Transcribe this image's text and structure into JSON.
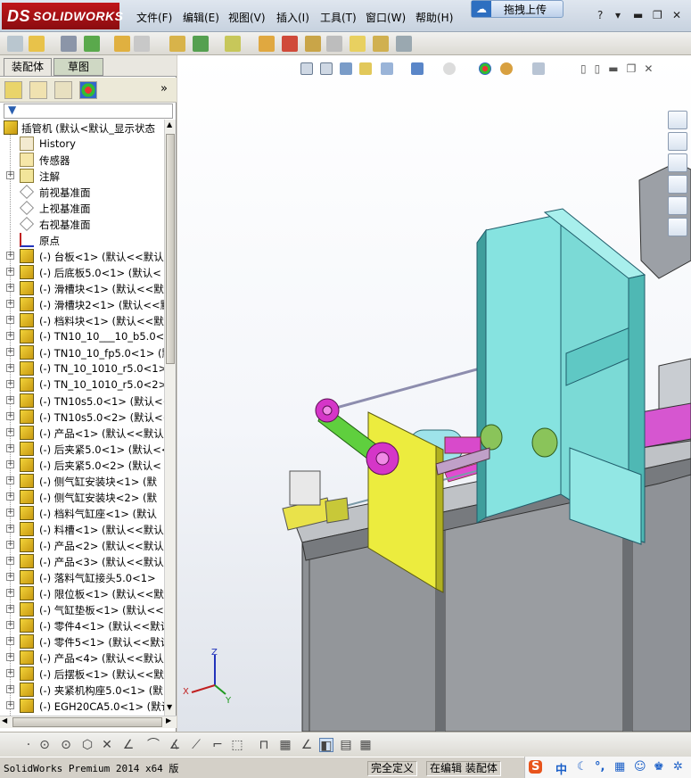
{
  "app": {
    "name": "SOLIDWORKS",
    "logo_prefix": "DS"
  },
  "menu": [
    "文件(F)",
    "编辑(E)",
    "视图(V)",
    "插入(I)",
    "工具(T)",
    "窗口(W)",
    "帮助(H)"
  ],
  "upload_button": "拖拽上传",
  "window_controls": [
    "?",
    "▾",
    "▬",
    "❐",
    "✕"
  ],
  "panel_tabs": [
    "装配体",
    "草图"
  ],
  "tree": {
    "root": "插管机  (默认<默认_显示状态",
    "items": [
      {
        "label": "History",
        "icon": "history-icon",
        "exp": false
      },
      {
        "label": "传感器",
        "icon": "sensor-icon",
        "exp": false
      },
      {
        "label": "注解",
        "icon": "annotation-icon",
        "exp": true
      },
      {
        "label": "前视基准面",
        "icon": "plane-icon",
        "exp": false
      },
      {
        "label": "上视基准面",
        "icon": "plane-icon",
        "exp": false
      },
      {
        "label": "右视基准面",
        "icon": "plane-icon",
        "exp": false
      },
      {
        "label": "原点",
        "icon": "origin-icon",
        "exp": false
      },
      {
        "label": "(-) 台板<1> (默认<<默认",
        "icon": "part-icon",
        "exp": true
      },
      {
        "label": "(-) 后底板5.0<1> (默认<",
        "icon": "part-icon",
        "exp": true
      },
      {
        "label": "(-) 滑槽块<1> (默认<<默",
        "icon": "part-icon",
        "exp": true
      },
      {
        "label": "(-) 滑槽块2<1> (默认<<默",
        "icon": "part-icon",
        "exp": true
      },
      {
        "label": "(-) 档料块<1> (默认<<默",
        "icon": "part-icon",
        "exp": true
      },
      {
        "label": "(-) TN10_10___10_b5.0<1",
        "icon": "part-icon",
        "exp": true
      },
      {
        "label": "(-) TN10_10_fp5.0<1> (默",
        "icon": "part-icon",
        "exp": true
      },
      {
        "label": "(-) TN_10_1010_r5.0<1>",
        "icon": "part-icon",
        "exp": true
      },
      {
        "label": "(-) TN_10_1010_r5.0<2>",
        "icon": "part-icon",
        "exp": true
      },
      {
        "label": "(-) TN10s5.0<1> (默认<<",
        "icon": "part-icon",
        "exp": true
      },
      {
        "label": "(-) TN10s5.0<2> (默认<<",
        "icon": "part-icon",
        "exp": true
      },
      {
        "label": "(-) 产品<1> (默认<<默认",
        "icon": "part-icon",
        "exp": true
      },
      {
        "label": "(-) 后夹紧5.0<1> (默认<<",
        "icon": "part-icon",
        "exp": true
      },
      {
        "label": "(-) 后夹紧5.0<2> (默认<",
        "icon": "part-icon",
        "exp": true
      },
      {
        "label": "(-) 侧气缸安装块<1> (默",
        "icon": "part-icon",
        "exp": true
      },
      {
        "label": "(-) 侧气缸安装块<2> (默",
        "icon": "part-icon",
        "exp": true
      },
      {
        "label": "(-) 档料气缸座<1> (默认",
        "icon": "part-icon",
        "exp": true
      },
      {
        "label": "(-) 料槽<1> (默认<<默认",
        "icon": "part-icon",
        "exp": true
      },
      {
        "label": "(-) 产品<2> (默认<<默认",
        "icon": "part-icon",
        "exp": true
      },
      {
        "label": "(-) 产品<3> (默认<<默认",
        "icon": "part-icon",
        "exp": true
      },
      {
        "label": "(-) 落料气缸接头5.0<1>",
        "icon": "part-icon",
        "exp": true
      },
      {
        "label": "(-) 限位板<1> (默认<<默",
        "icon": "part-icon",
        "exp": true
      },
      {
        "label": "(-) 气缸垫板<1> (默认<<",
        "icon": "part-icon",
        "exp": true
      },
      {
        "label": "(-) 零件4<1> (默认<<默认",
        "icon": "part-icon",
        "exp": true
      },
      {
        "label": "(-) 零件5<1> (默认<<默认",
        "icon": "part-icon",
        "exp": true
      },
      {
        "label": "(-) 产品<4> (默认<<默认",
        "icon": "part-icon",
        "exp": true
      },
      {
        "label": "(-) 后摆板<1> (默认<<默",
        "icon": "part-icon",
        "exp": true
      },
      {
        "label": "(-) 夹紧机构座5.0<1> (默",
        "icon": "part-icon",
        "exp": true
      },
      {
        "label": "(-) EGH20CA5.0<1> (默认",
        "icon": "part-icon",
        "exp": true
      }
    ]
  },
  "triad": {
    "x": "X",
    "y": "Y",
    "z": "Z"
  },
  "status": {
    "product": "SolidWorks Premium 2014 x64 版",
    "define": "完全定义",
    "edit": "在编辑 装配体"
  },
  "ime": {
    "label": "中"
  },
  "colors": {
    "brand": "#c0161a",
    "cyan_part": "#7fdede",
    "yellow_part": "#eaea3a",
    "magenta_part": "#d838c8",
    "frame_gray": "#8e9196"
  }
}
